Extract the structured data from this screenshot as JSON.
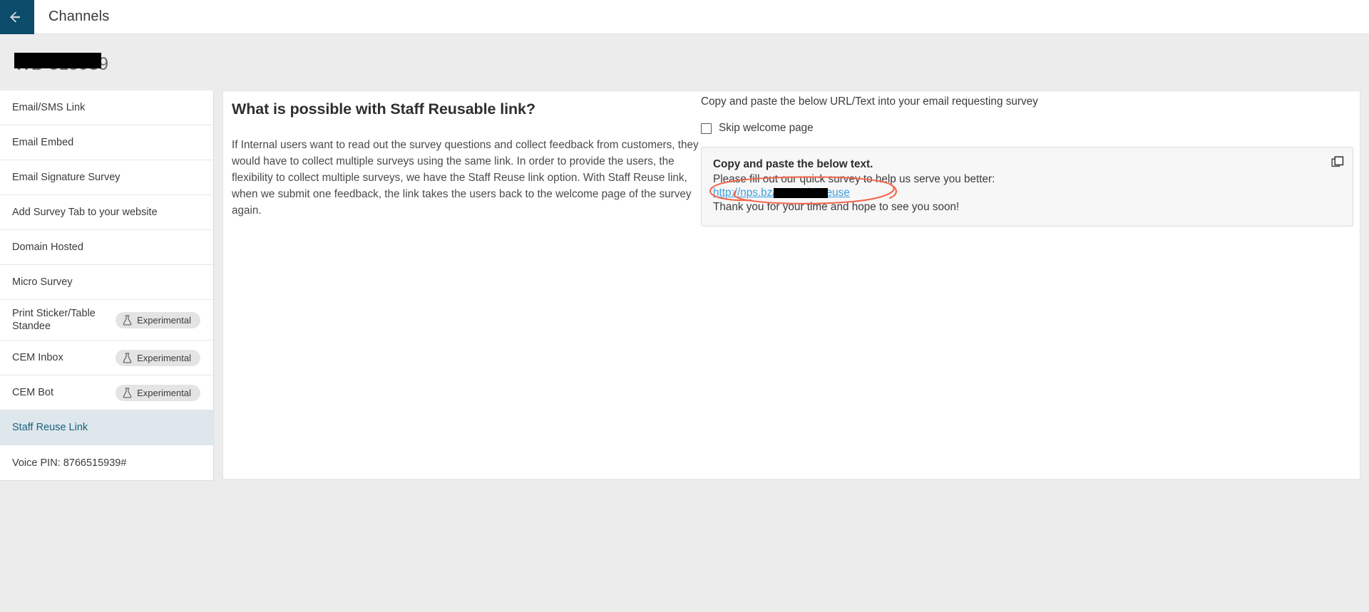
{
  "header": {
    "back_icon": "arrow-left-icon",
    "title": "Channels",
    "accent_color": "#0c4b69"
  },
  "page": {
    "survey_title": "WB-515939",
    "survey_title_redacted": true
  },
  "sidebar": {
    "items": [
      {
        "label": "Email/SMS Link",
        "badge": null,
        "selected": false
      },
      {
        "label": "Email Embed",
        "badge": null,
        "selected": false
      },
      {
        "label": "Email Signature Survey",
        "badge": null,
        "selected": false
      },
      {
        "label": "Add Survey Tab to your website",
        "badge": null,
        "selected": false
      },
      {
        "label": "Domain Hosted",
        "badge": null,
        "selected": false
      },
      {
        "label": "Micro Survey",
        "badge": null,
        "selected": false
      },
      {
        "label": "Print Sticker/Table Standee",
        "badge": "Experimental",
        "selected": false
      },
      {
        "label": "CEM Inbox",
        "badge": "Experimental",
        "selected": false
      },
      {
        "label": "CEM Bot",
        "badge": "Experimental",
        "selected": false
      },
      {
        "label": "Staff Reuse Link",
        "badge": null,
        "selected": true
      },
      {
        "label": "Voice PIN: 8766515939#",
        "badge": null,
        "selected": false
      }
    ],
    "badge_icon": "flask-icon",
    "selected_bg": "#dde7ec",
    "selected_text": "#1d5f7d"
  },
  "main": {
    "heading": "What is possible with Staff Reusable link?",
    "paragraph": "If Internal users want to read out the survey questions and collect feedback from customers, they would have to collect multiple surveys using the same link. In order to provide the users, the flexibility to collect multiple surveys, we have the Staff Reuse link option. With Staff Reuse link, when we submit one feedback, the link takes the users back to the welcome page of the survey again."
  },
  "panel": {
    "intro": "Copy and paste the below URL/Text into your email requesting survey",
    "skip_welcome_label": "Skip welcome page",
    "skip_welcome_checked": false,
    "copy_box": {
      "title": "Copy and paste the below text.",
      "line1": "Please fill out our quick survey to help us serve you better:",
      "url_prefix": "http://nps.bz/",
      "url_suffix": "9&mode=reuse",
      "url_redacted": true,
      "line3": "Thank you for your time and hope to see you soon!",
      "copy_icon": "copy-icon"
    },
    "annotation": {
      "shape": "hand-drawn-oval",
      "color": "#f4674e",
      "targets": "survey-url-link"
    }
  }
}
